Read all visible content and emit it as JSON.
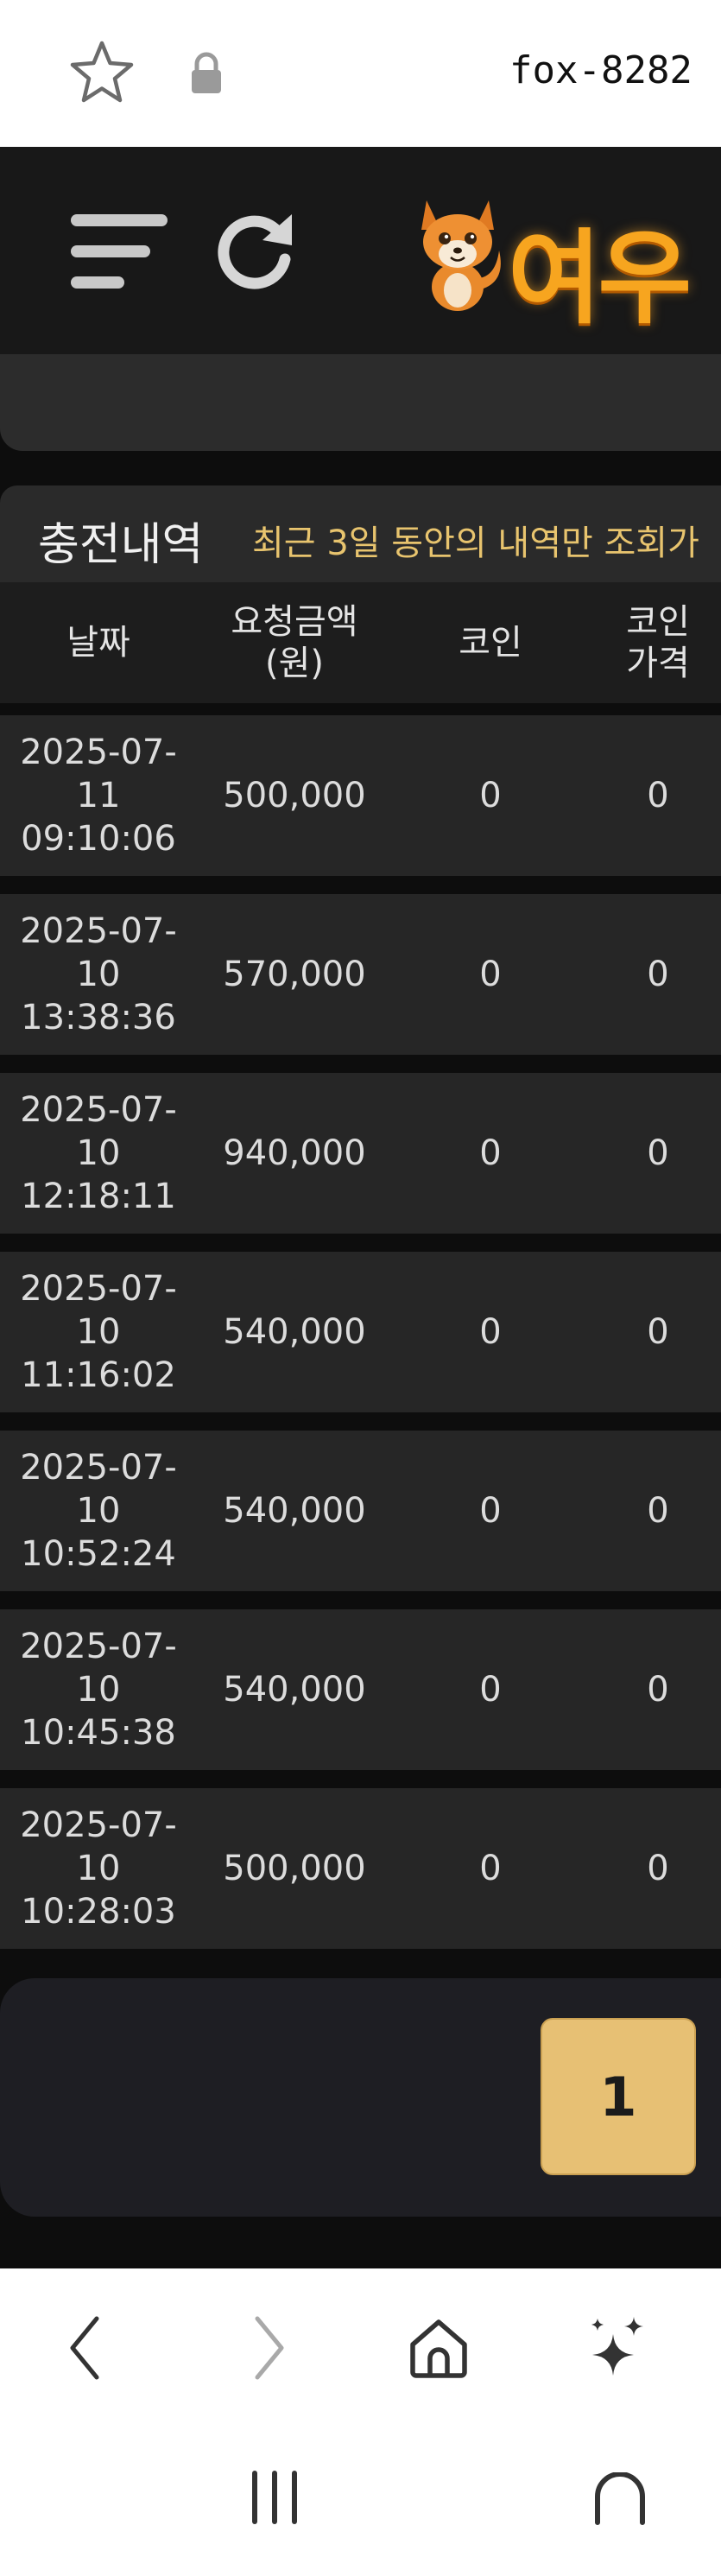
{
  "browser": {
    "url": "fox-8282",
    "icons": {
      "bookmark": "star-icon",
      "secure": "lock-icon"
    }
  },
  "header": {
    "logo_text": "여우",
    "icons": {
      "menu": "menu-icon",
      "refresh": "refresh-icon",
      "logo": "fox-mascot"
    }
  },
  "section": {
    "title": "충전내역",
    "note": "최근 3일 동안의 내역만 조회가"
  },
  "table": {
    "columns": [
      "날짜",
      "요청금액\n(원)",
      "코인",
      "코인\n가격"
    ],
    "rows": [
      {
        "date": "2025-07-\n11\n09:10:06",
        "amount": "500,000",
        "coin": "0",
        "price": "0"
      },
      {
        "date": "2025-07-\n10\n13:38:36",
        "amount": "570,000",
        "coin": "0",
        "price": "0"
      },
      {
        "date": "2025-07-\n10\n12:18:11",
        "amount": "940,000",
        "coin": "0",
        "price": "0"
      },
      {
        "date": "2025-07-\n10\n11:16:02",
        "amount": "540,000",
        "coin": "0",
        "price": "0"
      },
      {
        "date": "2025-07-\n10\n10:52:24",
        "amount": "540,000",
        "coin": "0",
        "price": "0"
      },
      {
        "date": "2025-07-\n10\n10:45:38",
        "amount": "540,000",
        "coin": "0",
        "price": "0"
      },
      {
        "date": "2025-07-\n10\n10:28:03",
        "amount": "500,000",
        "coin": "0",
        "price": "0"
      }
    ]
  },
  "pagination": {
    "current": "1"
  },
  "colors": {
    "accent": "#e7c074",
    "note": "#e8c46e",
    "background": "#0d0d0d",
    "row": "#262626",
    "logo": "#f7a51f"
  },
  "system_nav": {
    "icons": [
      "back-icon",
      "forward-icon",
      "home-icon",
      "sparkle-icon",
      "recents-icon",
      "system-home-icon"
    ]
  }
}
